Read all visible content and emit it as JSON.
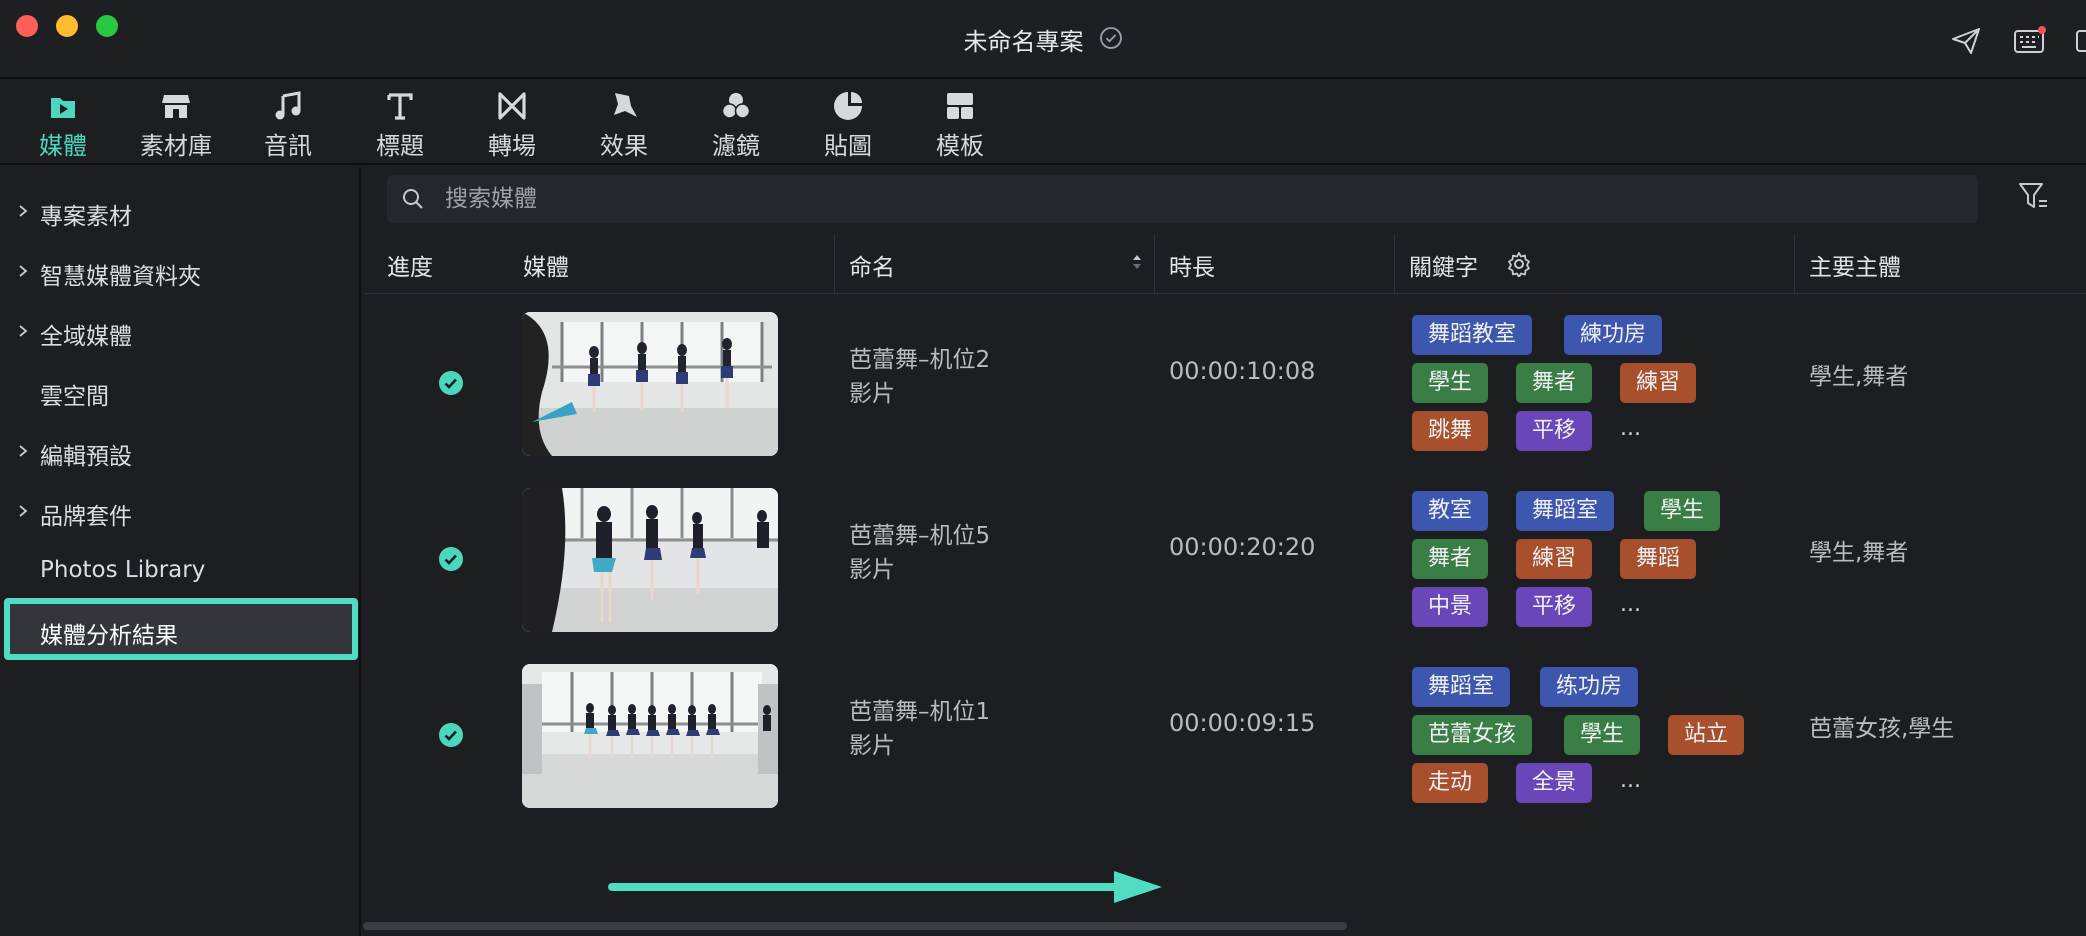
{
  "window": {
    "title": "未命名專案"
  },
  "toolbar": {
    "items": [
      {
        "label": "媒體",
        "icon": "media-icon",
        "active": true
      },
      {
        "label": "素材庫",
        "icon": "store-icon"
      },
      {
        "label": "音訊",
        "icon": "music-note-icon"
      },
      {
        "label": "標題",
        "icon": "text-icon"
      },
      {
        "label": "轉場",
        "icon": "transition-icon"
      },
      {
        "label": "效果",
        "icon": "effects-icon"
      },
      {
        "label": "濾鏡",
        "icon": "filter-circles-icon"
      },
      {
        "label": "貼圖",
        "icon": "sticker-icon"
      },
      {
        "label": "模板",
        "icon": "template-icon"
      }
    ],
    "accent": "#4ed6bd"
  },
  "sidebar": {
    "items": [
      {
        "label": "專案素材",
        "chevron": true
      },
      {
        "label": "智慧媒體資料夾",
        "chevron": true
      },
      {
        "label": "全域媒體",
        "chevron": true
      },
      {
        "label": "雲空間",
        "chevron": false
      },
      {
        "label": "編輯預設",
        "chevron": true
      },
      {
        "label": "品牌套件",
        "chevron": true
      },
      {
        "label": "Photos Library",
        "chevron": false
      },
      {
        "label": "媒體分析結果",
        "chevron": false,
        "active": true
      }
    ]
  },
  "search": {
    "placeholder": "搜索媒體"
  },
  "table": {
    "headers": {
      "progress": "進度",
      "media": "媒體",
      "name": "命名",
      "duration": "時長",
      "keywords": "關鍵字",
      "subject": "主要主體"
    },
    "rows": [
      {
        "name": "芭蕾舞–机位2",
        "type": "影片",
        "duration": "00:00:10:08",
        "subject": "學生,舞者",
        "tags": [
          {
            "text": "舞蹈教室",
            "color": "blue"
          },
          {
            "text": "練功房",
            "color": "blue"
          },
          {
            "text": "學生",
            "color": "green"
          },
          {
            "text": "舞者",
            "color": "green"
          },
          {
            "text": "練習",
            "color": "orange"
          },
          {
            "text": "跳舞",
            "color": "orange"
          },
          {
            "text": "平移",
            "color": "purple"
          }
        ],
        "more": "..."
      },
      {
        "name": "芭蕾舞–机位5",
        "type": "影片",
        "duration": "00:00:20:20",
        "subject": "學生,舞者",
        "tags": [
          {
            "text": "教室",
            "color": "blue"
          },
          {
            "text": "舞蹈室",
            "color": "blue"
          },
          {
            "text": "學生",
            "color": "green"
          },
          {
            "text": "舞者",
            "color": "green"
          },
          {
            "text": "練習",
            "color": "orange"
          },
          {
            "text": "舞蹈",
            "color": "orange"
          },
          {
            "text": "中景",
            "color": "purple"
          },
          {
            "text": "平移",
            "color": "purple"
          }
        ],
        "more": "..."
      },
      {
        "name": "芭蕾舞–机位1",
        "type": "影片",
        "duration": "00:00:09:15",
        "subject": "芭蕾女孩,學生",
        "tags": [
          {
            "text": "舞蹈室",
            "color": "blue"
          },
          {
            "text": "练功房",
            "color": "blue"
          },
          {
            "text": "芭蕾女孩",
            "color": "green"
          },
          {
            "text": "學生",
            "color": "green"
          },
          {
            "text": "站立",
            "color": "orange"
          },
          {
            "text": "走动",
            "color": "orange"
          },
          {
            "text": "全景",
            "color": "purple"
          }
        ],
        "more": "..."
      }
    ]
  },
  "colors": {
    "tag_blue": "#3e57ae",
    "tag_green": "#3a7d45",
    "tag_orange": "#a8502d",
    "tag_purple": "#6a47b8",
    "highlight": "#4fdcc0"
  }
}
